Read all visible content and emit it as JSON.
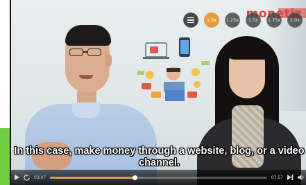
{
  "video": {
    "brand_text": "monetiz",
    "subtitle": "In this case, make money through a website, blog, or a video channel.",
    "accent_color": "#e99c3f",
    "brand_color": "#e0443c"
  },
  "speed_menu": {
    "list_icon": "playlist-icon",
    "options": [
      "1.0x",
      "1.25x",
      "1.5x",
      "1.75x",
      "2.0x"
    ],
    "selected": "1.0x"
  },
  "controls": {
    "play_icon": "play-icon",
    "replay_icon": "replay-icon",
    "current_time": "03:07",
    "duration": "07:57",
    "progress": 0.39,
    "next_icon": "next-icon",
    "volume_icon": "volume-icon"
  }
}
